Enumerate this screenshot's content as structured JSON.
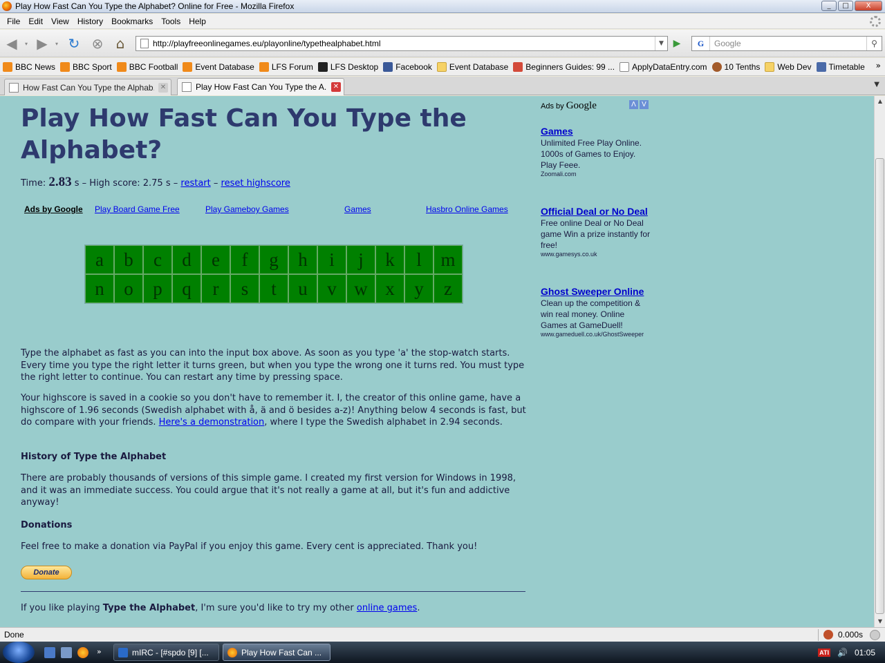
{
  "window": {
    "title": "Play How Fast Can You Type the Alphabet? Online for Free - Mozilla Firefox",
    "buttons": [
      "_",
      "□",
      "X"
    ]
  },
  "menu": [
    "File",
    "Edit",
    "View",
    "History",
    "Bookmarks",
    "Tools",
    "Help"
  ],
  "nav": {
    "url": "http://playfreeonlinegames.eu/playonline/typethealphabet.html",
    "search_placeholder": "Google",
    "search_engine_letter": "G"
  },
  "bookmarks": [
    {
      "label": "BBC News",
      "icon": "rss-icon"
    },
    {
      "label": "BBC Sport",
      "icon": "rss-icon"
    },
    {
      "label": "BBC Football",
      "icon": "rss-icon"
    },
    {
      "label": "Event Database",
      "icon": "rss-icon"
    },
    {
      "label": "LFS Forum",
      "icon": "rss-icon"
    },
    {
      "label": "LFS Desktop",
      "icon": "lfs-icon"
    },
    {
      "label": "Facebook",
      "icon": "facebook-icon"
    },
    {
      "label": "Event Database",
      "icon": "folder-icon"
    },
    {
      "label": "Beginners Guides: 99 ...",
      "icon": "pc-icon"
    },
    {
      "label": "ApplyDataEntry.com",
      "icon": "page-icon"
    },
    {
      "label": "10 Tenths",
      "icon": "tenths-icon"
    },
    {
      "label": "Web Dev",
      "icon": "folder-icon"
    },
    {
      "label": "Timetable",
      "icon": "cms-icon"
    }
  ],
  "tabs": [
    {
      "label": "How Fast Can You Type the Alphab...",
      "active": false
    },
    {
      "label": "Play How Fast Can You Type the A...",
      "active": true
    }
  ],
  "page": {
    "title": "Play How Fast Can You Type the Alphabet?",
    "time_label": "Time:",
    "time_value": "2.83",
    "time_unit": "s",
    "sep": "–",
    "highscore_text": "High score: 2.75 s",
    "restart": "restart",
    "reset": "reset highscore",
    "adrow": [
      "Ads by Google",
      "Play Board Game Free",
      "Play Gameboy Games",
      "Games",
      "Hasbro Online Games"
    ],
    "letters": [
      "a",
      "b",
      "c",
      "d",
      "e",
      "f",
      "g",
      "h",
      "i",
      "j",
      "k",
      "l",
      "m",
      "n",
      "o",
      "p",
      "q",
      "r",
      "s",
      "t",
      "u",
      "v",
      "w",
      "x",
      "y",
      "z"
    ],
    "p1": "Type the alphabet as fast as you can into the input box above. As soon as you type 'a' the stop-watch starts. Every time you type the right letter it turns green, but when you type the wrong one it turns red. You must type the right letter to continue. You can restart any time by pressing space.",
    "p2_a": "Your highscore is saved in a cookie so you don't have to remember it. I, the creator of this online game, have a highscore of 1.96 seconds (Swedish alphabet with å, ä and ö besides a-z)! Anything below 4 seconds is fast, but do compare with your friends.",
    "p2_link": "Here's a demonstration",
    "p2_b": ", where I type the Swedish alphabet in 2.94 seconds.",
    "h_history": "History of Type the Alphabet",
    "p3": "There are probably thousands of versions of this simple game. I created my first version for Windows in 1998, and it was an immediate success. You could argue that it's not really a game at all, but it's fun and addictive anyway!",
    "h_donations": "Donations",
    "p4": "Feel free to make a donation via PayPal if you enjoy this game. Every cent is appreciated. Thank you!",
    "donate": "Donate",
    "foot_a": "If you like playing",
    "foot_bold": "Type the Alphabet",
    "foot_b": ", I'm sure you'd like to try my other",
    "foot_link": "online games",
    "foot_end": "."
  },
  "sidebar": {
    "ads_by": "Ads by",
    "google": "Google",
    "ads": [
      {
        "title": "Games",
        "desc": "Unlimited Free Play Online. 1000s of Games to Enjoy. Play Feee.",
        "url": "Zoomali.com"
      },
      {
        "title": "Official Deal or No Deal",
        "desc": "Free online Deal or No Deal game Win a prize instantly for free!",
        "url": "www.gamesys.co.uk"
      },
      {
        "title": "Ghost Sweeper Online",
        "desc": "Clean up the competition & win real money. Online Games at GameDuell!",
        "url": "www.gameduell.co.uk/GhostSweeper"
      }
    ]
  },
  "status": {
    "text": "Done",
    "timer": "0.000s"
  },
  "taskbar": {
    "tasks": [
      {
        "label": "mIRC - [#spdo [9] [...",
        "active": false
      },
      {
        "label": "Play How Fast Can ...",
        "active": true
      }
    ],
    "tray_brand": "ATI",
    "clock": "01:05"
  },
  "colors": {
    "page_bg": "#99cccc",
    "heading": "#2e3a6e",
    "letter_cell": "#008000",
    "link": "#0000ee"
  }
}
